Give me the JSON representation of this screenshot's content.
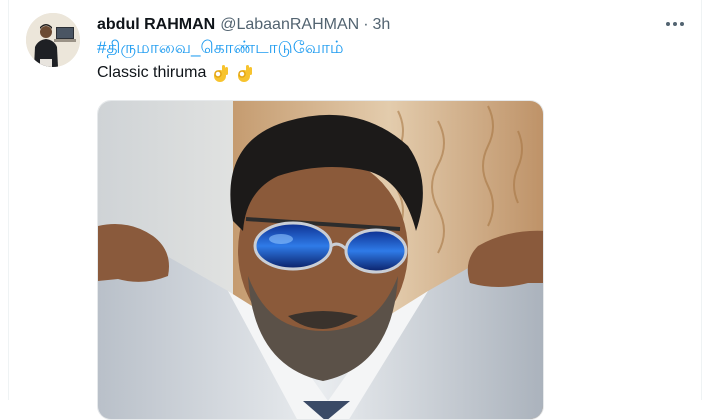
{
  "tweet": {
    "display_name": "abdul RAHMAN",
    "handle": "@LabaanRAHMAN",
    "separator": "·",
    "time": "3h",
    "hashtag": "#திருமாவை_கொண்டாடுவோம்",
    "text": "Classic thiruma",
    "emojis": [
      "ok-hand-emoji",
      "ok-hand-emoji"
    ]
  },
  "icons": {
    "more": "more-horizontal-icon"
  },
  "colors": {
    "link": "#1d9bf0",
    "text_primary": "#0f1419",
    "text_secondary": "#536471"
  }
}
